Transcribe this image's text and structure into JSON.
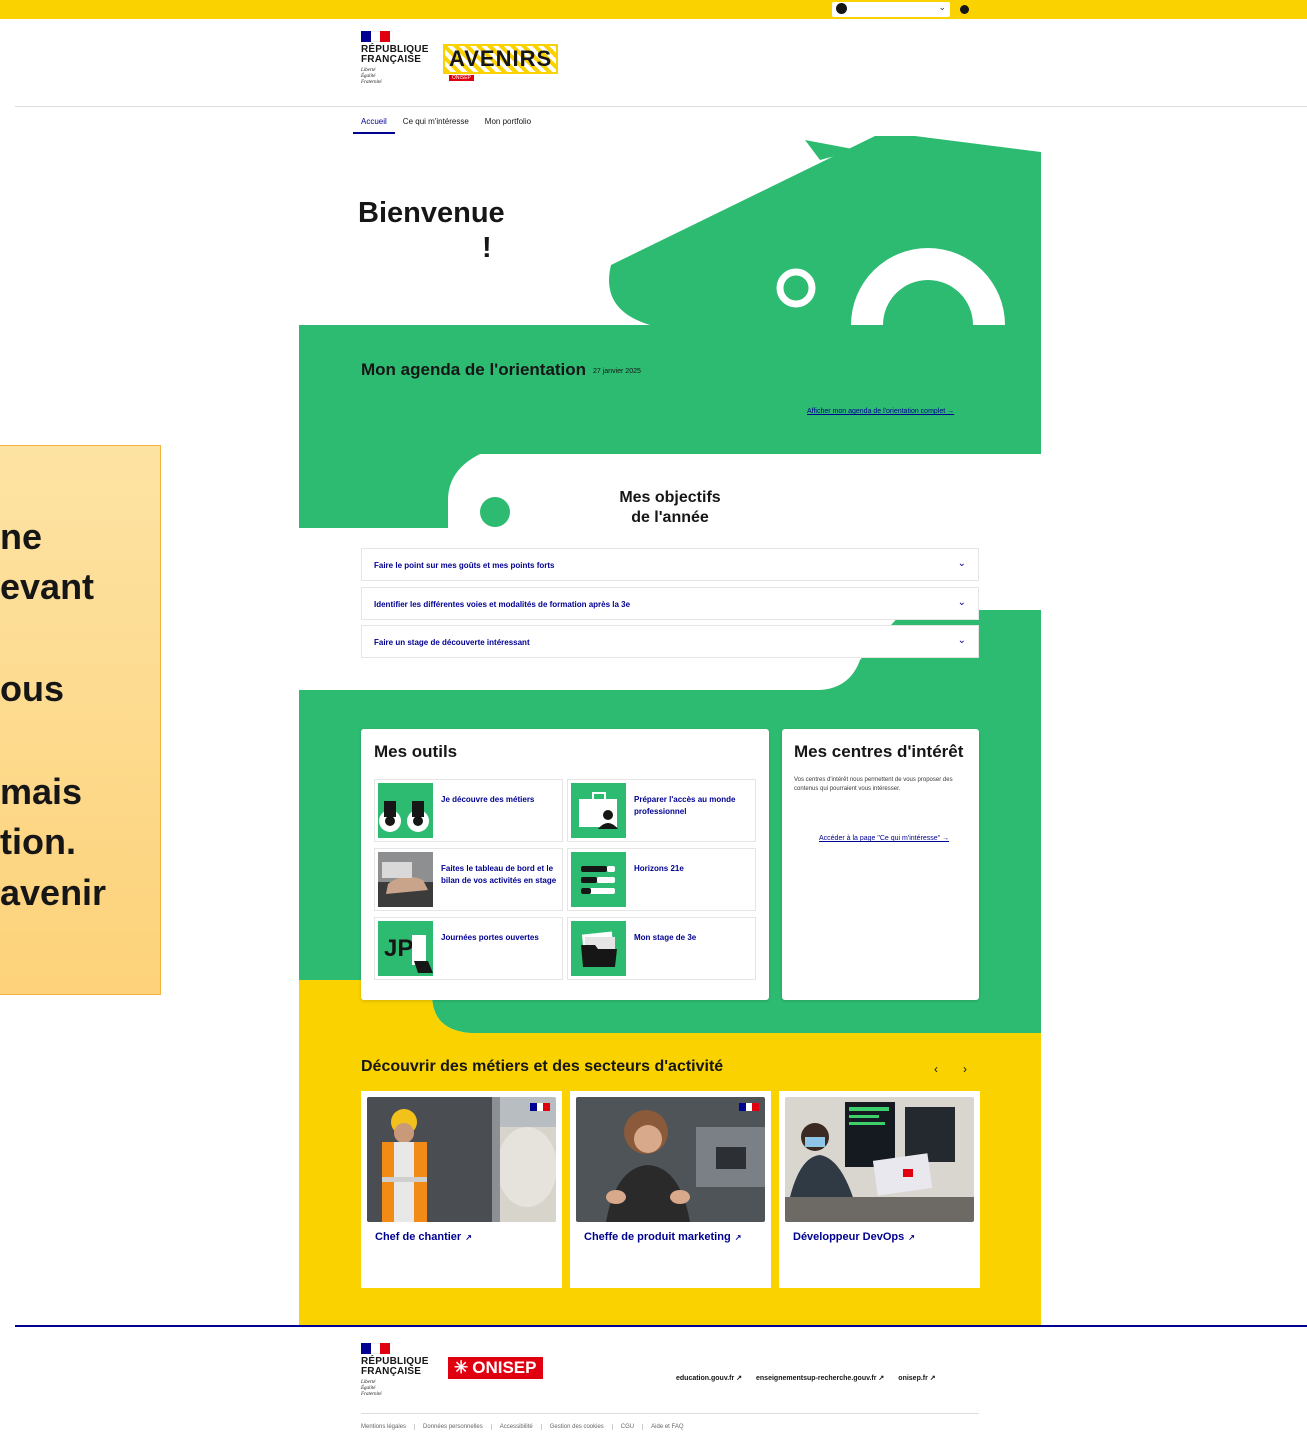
{
  "republique": {
    "name": "RÉPUBLIQUE\nFRANÇAISE",
    "motto": "Liberté\nÉgalité\nFraternité",
    "flag_colors": [
      "#000091",
      "#ffffff",
      "#e1000f"
    ]
  },
  "brand": {
    "logo_text": "AVENIRS",
    "badge": "ONISEP"
  },
  "nav": {
    "items": [
      {
        "label": "Accueil"
      },
      {
        "label": "Ce qui m'intéresse"
      },
      {
        "label": "Mon portfolio"
      }
    ]
  },
  "welcome": {
    "line1": "Bienvenue",
    "line2": "!"
  },
  "agenda": {
    "title": "Mon agenda de l'orientation",
    "date": "27 janvier 2025",
    "link": "Afficher mon agenda de l'orientation complet →"
  },
  "objectifs": {
    "title": "Mes objectifs\nde l'année",
    "items": [
      {
        "label": "Faire le point sur mes goûts et mes points forts"
      },
      {
        "label": "Identifier les différentes voies et modalités de formation après la 3e"
      },
      {
        "label": "Faire un stage de découverte intéressant"
      }
    ]
  },
  "outils": {
    "title": "Mes outils",
    "items": [
      {
        "label": "Je découvre des métiers"
      },
      {
        "label": "Préparer l'accès au monde professionnel"
      },
      {
        "label": "Faites le tableau de bord et le bilan de vos activités en stage"
      },
      {
        "label": "Horizons 21e"
      },
      {
        "label": "Journées portes ouvertes",
        "thumb_text": "JP"
      },
      {
        "label": "Mon stage de 3e"
      }
    ]
  },
  "centres": {
    "title": "Mes centres d'intérêt",
    "text": "Vos centres d'intérêt nous permettent de vous proposer des contenus qui pourraient vous intéresser.",
    "link": "Accéder à la page \"Ce qui m'intéresse\"  →"
  },
  "jobs": {
    "title": "Découvrir des métiers et des secteurs d'activité",
    "prev": "‹",
    "next": "›",
    "items": [
      {
        "label": "Chef de chantier"
      },
      {
        "label": "Cheffe de produit marketing"
      },
      {
        "label": "Développeur DevOps"
      }
    ]
  },
  "footer": {
    "onisep": "ONISEP",
    "links": [
      {
        "label": "education.gouv.fr ↗"
      },
      {
        "label": "enseignementsup-recherche.gouv.fr ↗"
      },
      {
        "label": "onisep.fr ↗"
      }
    ],
    "bottom": [
      {
        "label": "Mentions légales"
      },
      {
        "label": "Données personnelles"
      },
      {
        "label": "Accessibilité"
      },
      {
        "label": "Gestion des cookies"
      },
      {
        "label": "CGU"
      },
      {
        "label": "Aide et FAQ"
      }
    ]
  },
  "side_panel": {
    "lines": [
      "ne",
      "evant",
      "ous",
      " mais",
      "tion.",
      "avenir"
    ]
  },
  "colors": {
    "green": "#2dbb72",
    "yellow": "#f9d200",
    "blue_france": "#000091"
  }
}
